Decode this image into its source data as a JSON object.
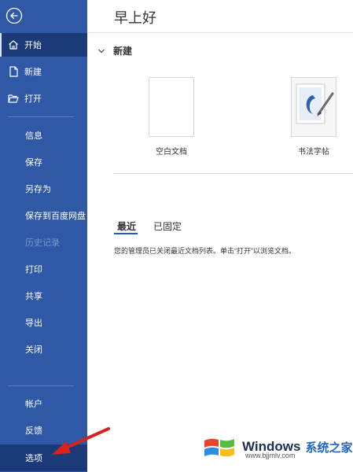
{
  "greeting": "早上好",
  "sidebar": {
    "items": [
      {
        "label": "开始"
      },
      {
        "label": "新建"
      },
      {
        "label": "打开"
      },
      {
        "label": "信息"
      },
      {
        "label": "保存"
      },
      {
        "label": "另存为"
      },
      {
        "label": "保存到百度网盘"
      },
      {
        "label": "历史记录"
      },
      {
        "label": "打印"
      },
      {
        "label": "共享"
      },
      {
        "label": "导出"
      },
      {
        "label": "关闭"
      },
      {
        "label": "帐户"
      },
      {
        "label": "反馈"
      },
      {
        "label": "选项"
      }
    ]
  },
  "new_section": {
    "title": "新建",
    "templates": [
      {
        "label": "空白文档"
      },
      {
        "label": "书法字帖"
      }
    ]
  },
  "recent": {
    "tabs": [
      {
        "label": "最近"
      },
      {
        "label": "已固定"
      }
    ],
    "notice": "您的管理员已关闭最近文档列表。单击“打开”以浏览文档。"
  },
  "watermark": {
    "brand": "Windows",
    "cn": "系统之家",
    "url": "www.bjjmlv.com"
  },
  "colors": {
    "sidebar": "#2f59a6",
    "sidebar_active": "#1b3a77",
    "accent_arrow": "#d9211d"
  }
}
